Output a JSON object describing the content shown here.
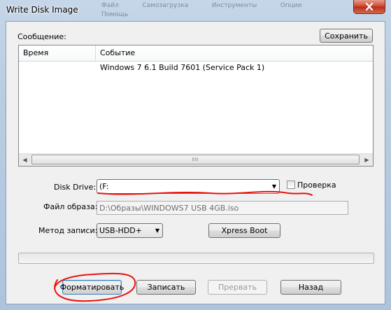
{
  "window": {
    "title": "Write Disk Image",
    "background_menu": [
      "Файл",
      "Самозагрузка",
      "Инструменты",
      "Опции",
      "Помощь"
    ],
    "close_icon": "close-icon"
  },
  "message_section": {
    "label": "Сообщение:",
    "save_button": "Сохранить",
    "columns": [
      "Время",
      "Событие"
    ],
    "rows": [
      {
        "time": "",
        "event": "Windows 7 6.1 Build 7601 (Service Pack 1)"
      }
    ],
    "scroll_left_icon": "scroll-left-icon",
    "scroll_right_icon": "scroll-right-icon",
    "scroll_grip": "III"
  },
  "disk_drive": {
    "label": "Disk Drive:",
    "value": "(F:",
    "verify_label": "Проверка",
    "verify_checked": false
  },
  "image_file": {
    "label": "Файл образа:",
    "value": "D:\\Образы\\WINDOWS7 USB 4GB.iso"
  },
  "write_method": {
    "label": "Метод записи:",
    "value": "USB-HDD+",
    "xpress_button": "Xpress Boot"
  },
  "progress": {
    "fraction": 0
  },
  "buttons": {
    "format": "Форматировать",
    "write": "Записать",
    "abort": "Прервать",
    "back": "Назад"
  },
  "annotation_color": "#e8120c"
}
